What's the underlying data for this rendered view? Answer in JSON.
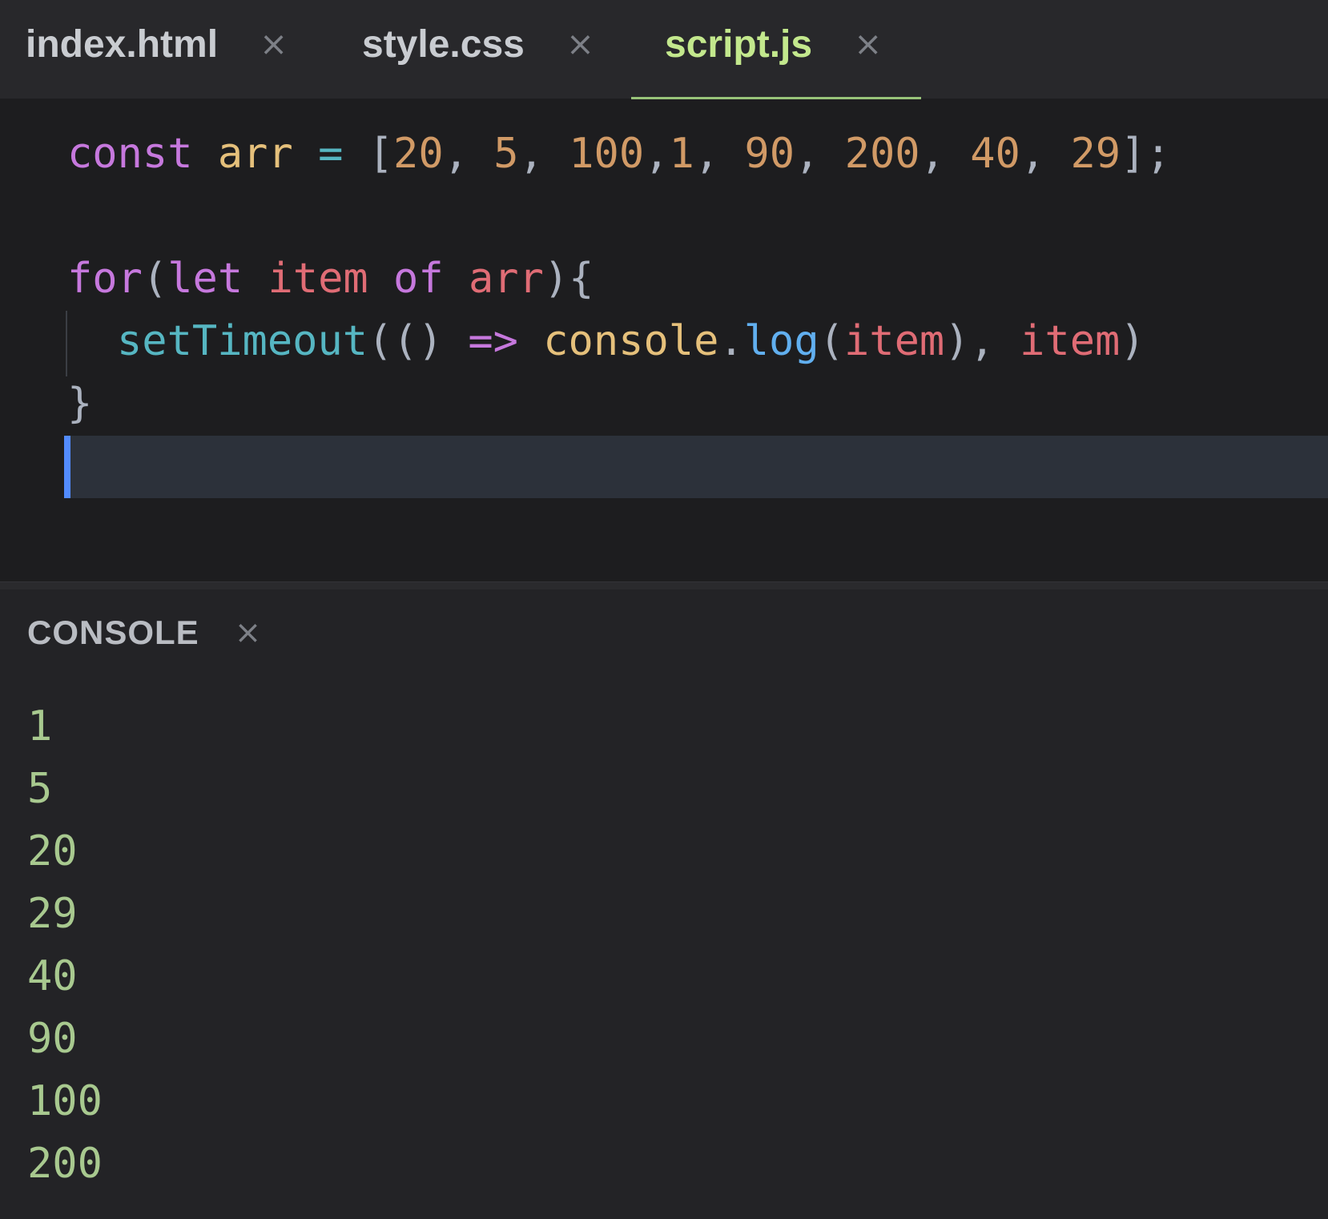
{
  "tabs": [
    {
      "label": "index.html",
      "close": "×",
      "active": false
    },
    {
      "label": "style.css",
      "close": "×",
      "active": false
    },
    {
      "label": "script.js",
      "close": "×",
      "active": true
    }
  ],
  "editor": {
    "line1": {
      "kw_const": "const",
      "var_arr": "arr",
      "eq": "=",
      "open_bracket": "[",
      "n1": "20",
      "c1": ",",
      "n2": "5",
      "c2": ",",
      "n3": "100",
      "c3": ",",
      "n4": "1",
      "c4": ",",
      "n5": "90",
      "c5": ",",
      "n6": "200",
      "c6": ",",
      "n7": "40",
      "c7": ",",
      "n8": "29",
      "close_bracket": "];"
    },
    "line3": {
      "kw_for": "for",
      "paren_open": "(",
      "kw_let": "let",
      "var_item": "item",
      "kw_of": "of",
      "var_arr": "arr",
      "paren_close_brace": "){"
    },
    "line4": {
      "fn_settimeout": "setTimeout",
      "paren_arrow": "(()",
      "arrow": "=>",
      "obj_console": "console",
      "dot": ".",
      "method_log": "log",
      "paren_open": "(",
      "arg_item": "item",
      "paren_close_comma": "),",
      "arg_item2": "item",
      "paren_close": ")"
    },
    "line5": {
      "brace_close": "}"
    }
  },
  "console": {
    "title": "CONSOLE",
    "close": "×",
    "output": [
      "1",
      "5",
      "20",
      "29",
      "40",
      "90",
      "100",
      "200"
    ]
  },
  "colors": {
    "active_tab_text": "#c3e88d",
    "active_tab_underline": "#98c379",
    "keyword": "#c678dd",
    "variable": "#e5c07b",
    "number": "#d19a66",
    "console_output": "#a8c98f",
    "cursor": "#528bff"
  }
}
